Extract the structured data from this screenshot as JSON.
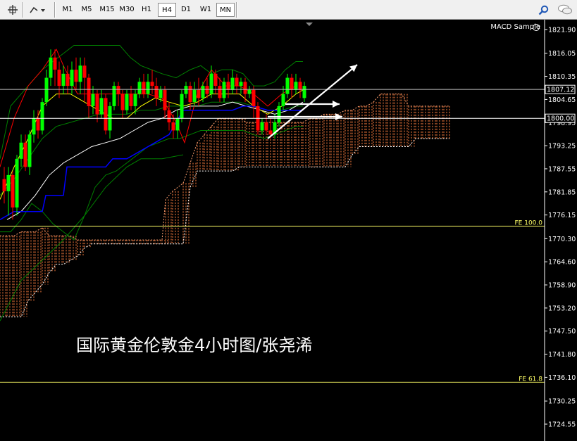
{
  "toolbar": {
    "timeframes": [
      "M1",
      "M5",
      "M15",
      "M30",
      "H1",
      "H4",
      "D1",
      "W1",
      "MN"
    ],
    "active_timeframe": "H4"
  },
  "indicator_label": "MACD Sample",
  "overlay_title": "国际黄金伦敦金4小时图/张尧浠",
  "price_axis": {
    "ticks": [
      "1821.90",
      "1816.05",
      "1810.35",
      "1804.65",
      "1798.95",
      "1793.25",
      "1787.55",
      "1781.85",
      "1776.15",
      "1770.30",
      "1764.60",
      "1758.90",
      "1753.20",
      "1747.50",
      "1741.80",
      "1736.10",
      "1730.25",
      "1724.55"
    ],
    "current_price": "1807.12",
    "level_1800": "1800.00"
  },
  "fib_levels": [
    {
      "label": "FE 100.0",
      "price": 1773.4,
      "color": "#ffff66"
    },
    {
      "label": "FE 61.8",
      "price": 1734.9,
      "color": "#ffff66"
    }
  ],
  "colors": {
    "bull": "#00ff00",
    "bear": "#ff0000",
    "tenkan": "#ff0000",
    "kijun": "#0000ff",
    "ma_white": "#ffffff",
    "ma_yellow": "#ffff00",
    "bollinger": "#008000",
    "cloud": "#ff8040",
    "lagging": "#008000"
  }
}
